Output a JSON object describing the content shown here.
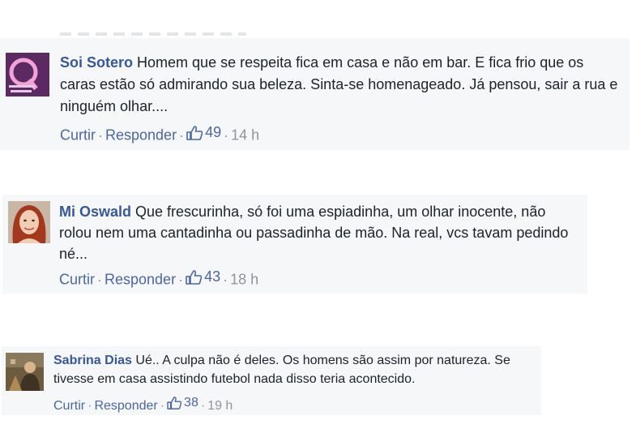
{
  "comments": [
    {
      "author": "Soi Sotero",
      "text": "Homem que se respeita fica em casa e não em bar. E fica frio que os caras estão só admirando sua beleza. Sinta-se homenageado. Já pensou, sair a rua e ninguém olhar....",
      "like_label": "Curtir",
      "reply_label": "Responder",
      "likes": "49",
      "time": "14 h",
      "avatar_icon": "purple-logo-avatar"
    },
    {
      "author": "Mi Oswald",
      "text": "Que frescurinha, só foi uma espiadinha, um olhar inocente, não rolou nem uma cantadinha ou passadinha de mão. Na real, vcs tavam pedindo né...",
      "like_label": "Curtir",
      "reply_label": "Responder",
      "likes": "43",
      "time": "18 h",
      "avatar_icon": "redhead-avatar"
    },
    {
      "author": "Sabrina Dias",
      "text": "Ué.. A culpa não é deles. Os homens são assim por natureza. Se tivesse em casa assistindo futebol nada disso teria acontecido.",
      "like_label": "Curtir",
      "reply_label": "Responder",
      "likes": "38",
      "time": "19 h",
      "avatar_icon": "photo-avatar"
    }
  ],
  "colors": {
    "author": "#365899",
    "link": "#4b67a1",
    "meta": "#90949c",
    "comment_bg": "#f6f7f9"
  }
}
